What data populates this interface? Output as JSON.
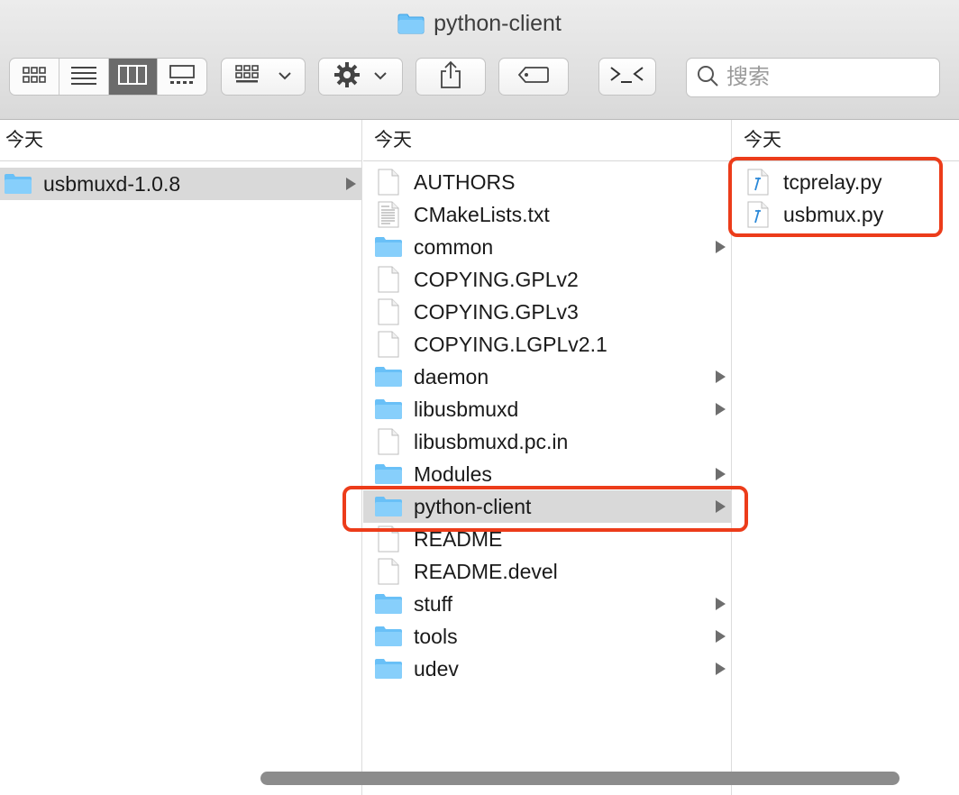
{
  "window": {
    "title": "python-client",
    "title_icon": "folder-icon"
  },
  "toolbar": {
    "view_modes": [
      {
        "name": "icon-view",
        "icon": "grid-icon",
        "active": false
      },
      {
        "name": "list-view",
        "icon": "list-icon",
        "active": false
      },
      {
        "name": "column-view",
        "icon": "columns-icon",
        "active": true
      },
      {
        "name": "gallery-view",
        "icon": "gallery-icon",
        "active": false
      }
    ],
    "group_button_icon": "group-grid-icon",
    "action_button_icon": "gear-icon",
    "share_button_icon": "share-icon",
    "tag_button_icon": "tag-icon",
    "terminal_button_icon": "terminal-icon",
    "search": {
      "placeholder": "搜索",
      "icon": "search-icon"
    }
  },
  "columns": [
    {
      "header": "今天",
      "items": [
        {
          "label": "usbmuxd-1.0.8",
          "type": "folder",
          "has_children": true,
          "selected": true
        }
      ]
    },
    {
      "header": "今天",
      "items": [
        {
          "label": "AUTHORS",
          "type": "file",
          "has_children": false
        },
        {
          "label": "CMakeLists.txt",
          "type": "text-file",
          "has_children": false
        },
        {
          "label": "common",
          "type": "folder",
          "has_children": true
        },
        {
          "label": "COPYING.GPLv2",
          "type": "file",
          "has_children": false
        },
        {
          "label": "COPYING.GPLv3",
          "type": "file",
          "has_children": false
        },
        {
          "label": "COPYING.LGPLv2.1",
          "type": "file",
          "has_children": false
        },
        {
          "label": "daemon",
          "type": "folder",
          "has_children": true
        },
        {
          "label": "libusbmuxd",
          "type": "folder",
          "has_children": true
        },
        {
          "label": "libusbmuxd.pc.in",
          "type": "file",
          "has_children": false
        },
        {
          "label": "Modules",
          "type": "folder",
          "has_children": true
        },
        {
          "label": "python-client",
          "type": "folder",
          "has_children": true,
          "selected": true
        },
        {
          "label": "README",
          "type": "file",
          "has_children": false
        },
        {
          "label": "README.devel",
          "type": "file",
          "has_children": false
        },
        {
          "label": "stuff",
          "type": "folder",
          "has_children": true
        },
        {
          "label": "tools",
          "type": "folder",
          "has_children": true
        },
        {
          "label": "udev",
          "type": "folder",
          "has_children": true
        }
      ]
    },
    {
      "header": "今天",
      "items": [
        {
          "label": "tcprelay.py",
          "type": "python-file",
          "has_children": false
        },
        {
          "label": "usbmux.py",
          "type": "python-file",
          "has_children": false
        }
      ]
    }
  ],
  "highlight_color": "#ec3c1a",
  "folder_color": "#5bb8f5"
}
